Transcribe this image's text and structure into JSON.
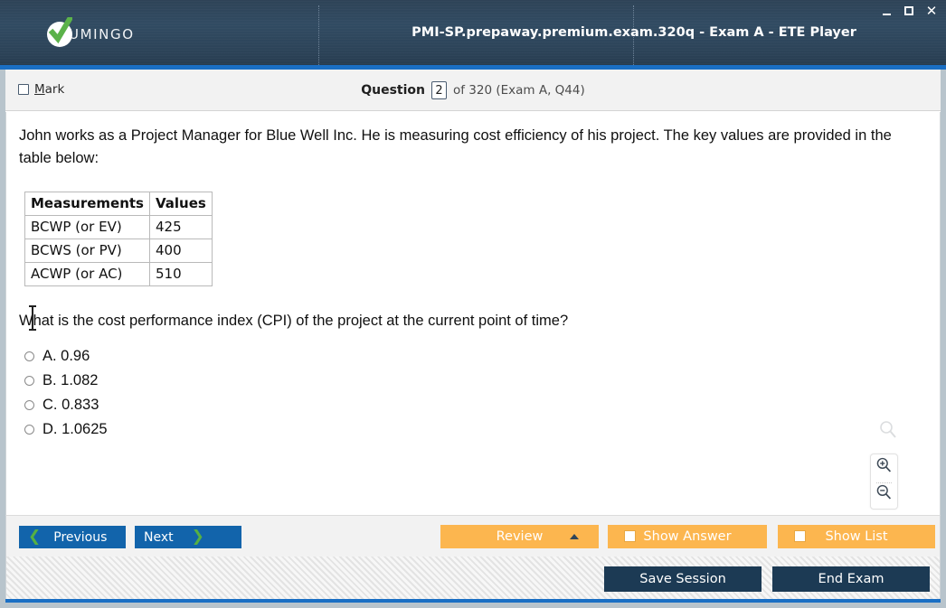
{
  "titlebar": {
    "brand_name": "UMINGO",
    "window_title": "PMI-SP.prepaway.premium.exam.320q - Exam A - ETE Player",
    "controls": {
      "minimize": "_",
      "maximize": "□",
      "close": "✕"
    }
  },
  "question_header": {
    "mark_label_prefix": "M",
    "mark_label_rest": "ark",
    "question_label": "Question",
    "question_number": "2",
    "question_rest": "of 320 (Exam A, Q44)"
  },
  "content": {
    "stem": "John works as a Project Manager for Blue Well Inc. He is measuring cost efficiency of his project. The key values are provided in the table below:",
    "table": {
      "headers": [
        "Measurements",
        "Values"
      ],
      "rows": [
        [
          "BCWP (or EV)",
          "425"
        ],
        [
          "BCWS (or PV)",
          "400"
        ],
        [
          "ACWP (or AC)",
          "510"
        ]
      ]
    },
    "question": "What is the cost performance index (CPI) of the project at the current point of time?",
    "options": [
      {
        "label": "A. 0.96"
      },
      {
        "label": "B. 1.082"
      },
      {
        "label": "C. 0.833"
      },
      {
        "label": "D. 1.0625"
      }
    ]
  },
  "action_bar": {
    "previous": "Previous",
    "next": "Next",
    "review": "Review",
    "show_answer": "Show Answer",
    "show_list": "Show List"
  },
  "footer": {
    "save_session": "Save Session",
    "end_exam": "End Exam"
  },
  "colors": {
    "titlebar": "#2e4357",
    "accent_blue": "#1a6fc4",
    "button_blue": "#1264ab",
    "button_orange": "#fcb64f",
    "button_dark": "#1c3a54",
    "chevron_green": "#56b043"
  }
}
